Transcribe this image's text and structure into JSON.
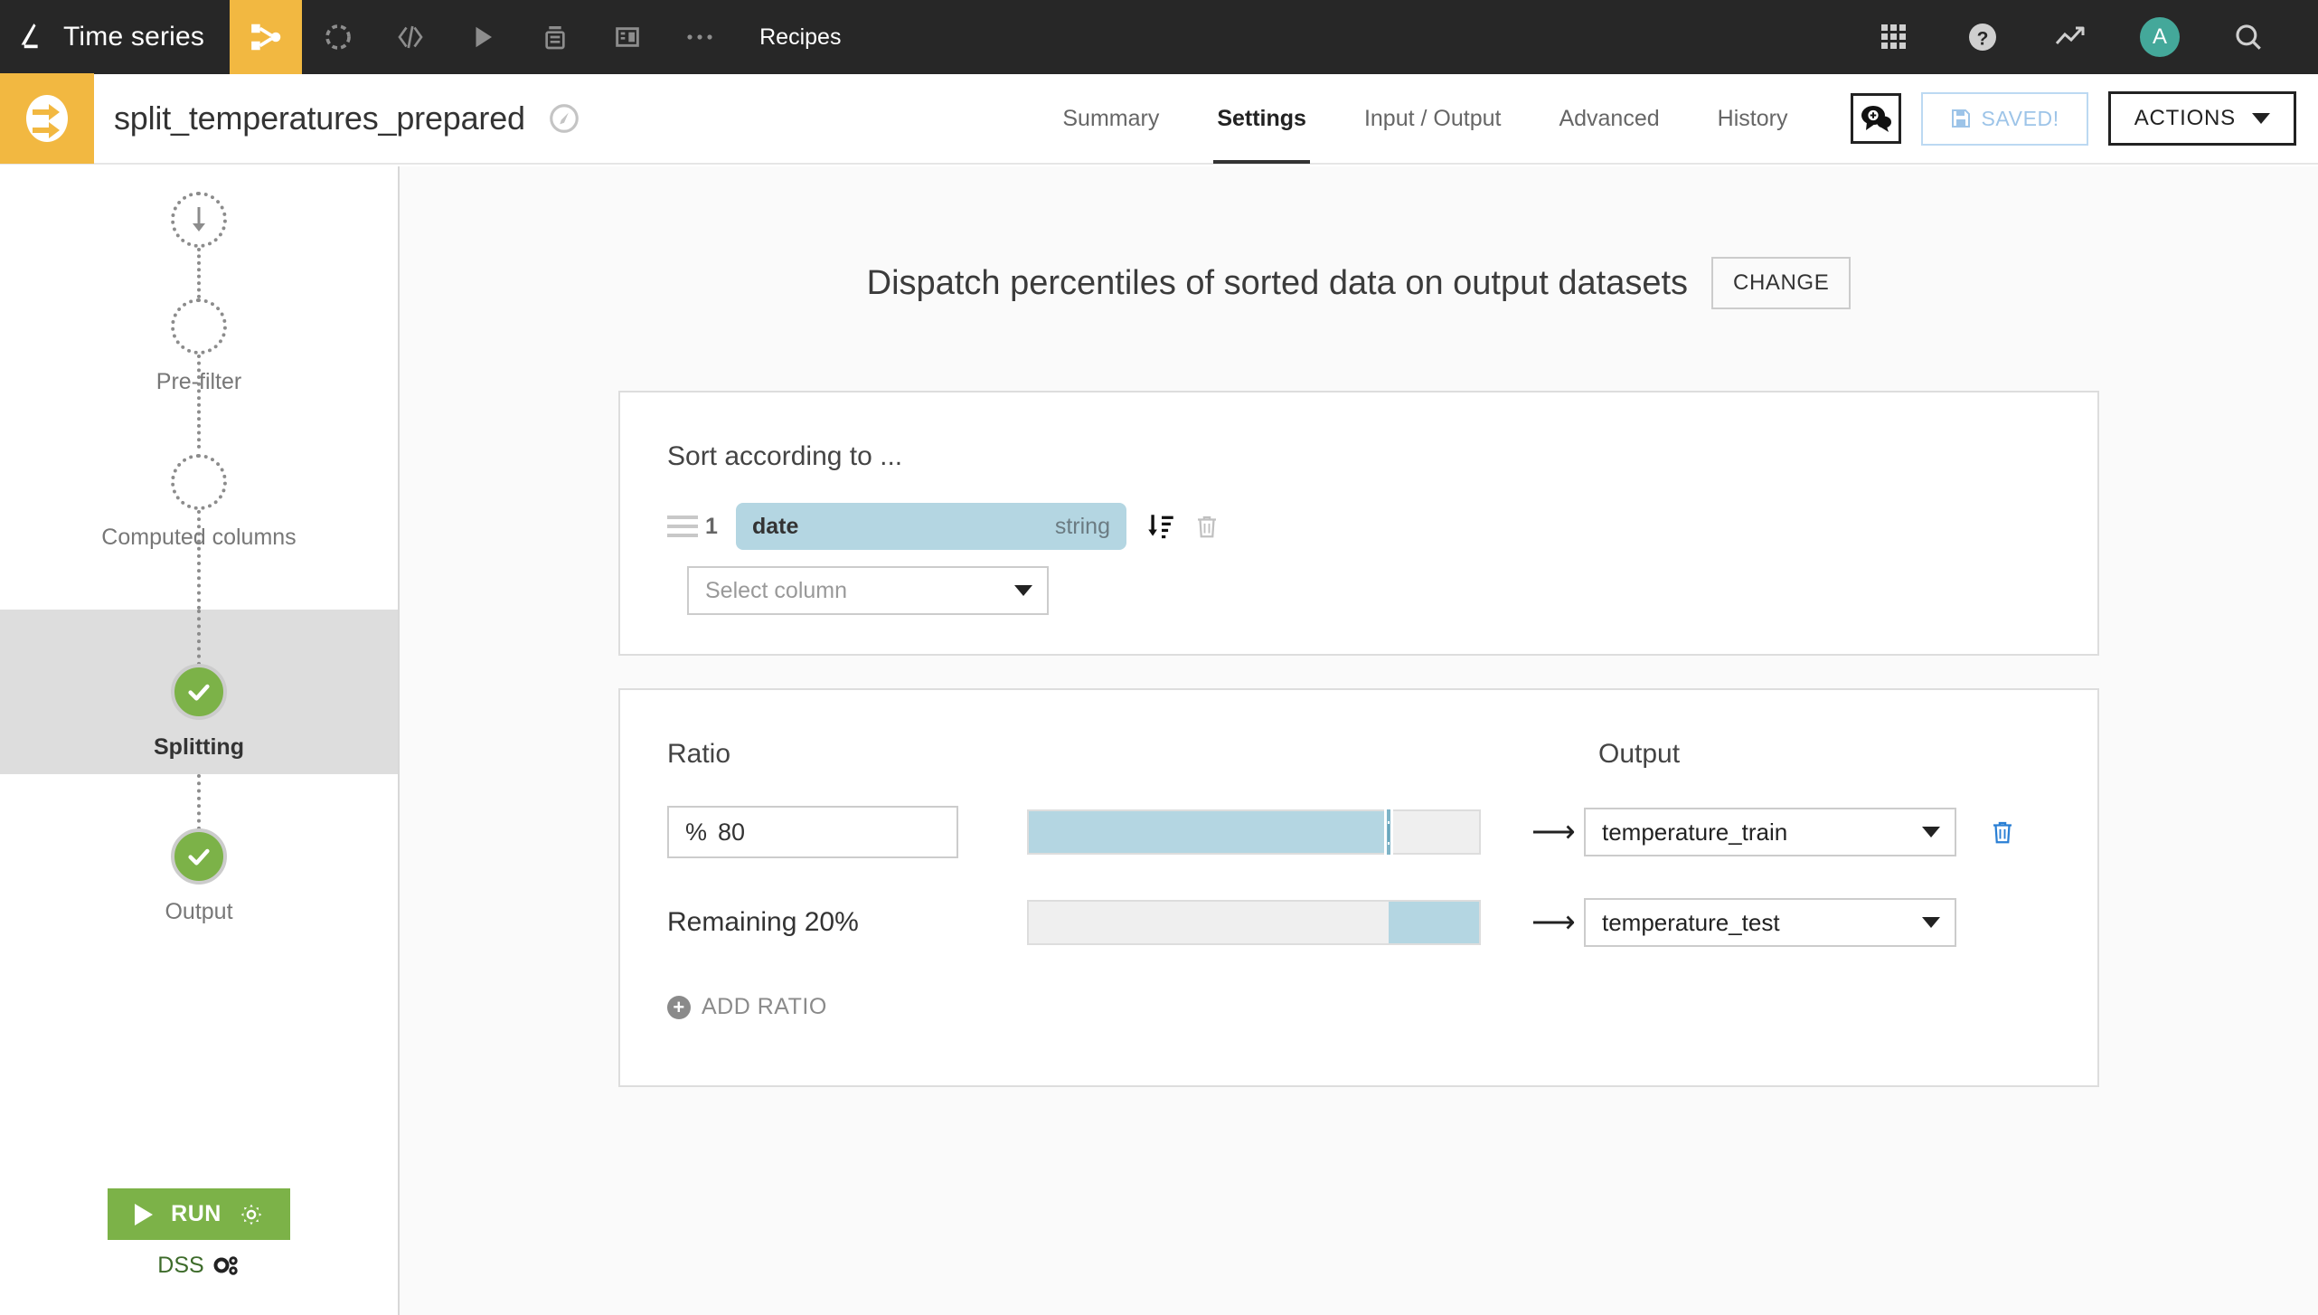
{
  "topbar": {
    "project_label": "Time series",
    "icons": [
      {
        "name": "flow-icon",
        "active": true
      },
      {
        "name": "dataset-icon",
        "active": false
      },
      {
        "name": "code-icon",
        "active": false
      },
      {
        "name": "jobs-play-icon",
        "active": false
      },
      {
        "name": "scenarios-icon",
        "active": false
      },
      {
        "name": "dashboard-icon",
        "active": false
      },
      {
        "name": "more-ellipsis-icon",
        "active": false
      }
    ],
    "section_label": "Recipes",
    "right_icons": [
      "apps-grid-icon",
      "help-icon",
      "trend-icon",
      "search-icon"
    ],
    "avatar_initial": "A"
  },
  "header": {
    "recipe_title": "split_temperatures_prepared",
    "tabs": [
      {
        "label": "Summary",
        "active": false
      },
      {
        "label": "Settings",
        "active": true
      },
      {
        "label": "Input / Output",
        "active": false
      },
      {
        "label": "Advanced",
        "active": false
      },
      {
        "label": "History",
        "active": false
      }
    ],
    "discussion_icon": "discussion-icon",
    "saved_label": "SAVED!",
    "actions_label": "ACTIONS"
  },
  "sidebar": {
    "steps": [
      {
        "label": "",
        "state": "input-arrow"
      },
      {
        "label": "Pre-filter",
        "state": "empty"
      },
      {
        "label": "Computed columns",
        "state": "empty"
      },
      {
        "label": "Splitting",
        "state": "done",
        "selected": true
      },
      {
        "label": "Output",
        "state": "done",
        "selected": false
      }
    ],
    "run_label": "RUN",
    "dss_label": "DSS"
  },
  "main": {
    "title": "Dispatch percentiles of sorted data on output datasets",
    "change_label": "CHANGE",
    "sort_card": {
      "title": "Sort according to ...",
      "rows": [
        {
          "index": "1",
          "column": "date",
          "type": "string"
        }
      ],
      "select_placeholder": "Select column"
    },
    "ratio_card": {
      "ratio_label": "Ratio",
      "output_label": "Output",
      "rows": [
        {
          "kind": "input",
          "percent_prefix": "%",
          "percent_value": "80",
          "fill_percent": 80,
          "fill_side": "left",
          "output": "temperature_train",
          "has_delete": true
        },
        {
          "kind": "remaining",
          "remaining_label": "Remaining 20%",
          "fill_percent": 20,
          "fill_side": "right",
          "output": "temperature_test",
          "has_delete": false
        }
      ],
      "add_ratio_label": "ADD RATIO"
    }
  },
  "colors": {
    "topbar_bg": "#272727",
    "accent_orange": "#f2b841",
    "green": "#7cb248",
    "slider_blue": "#b4d6e2",
    "avatar_teal": "#44a89a"
  }
}
